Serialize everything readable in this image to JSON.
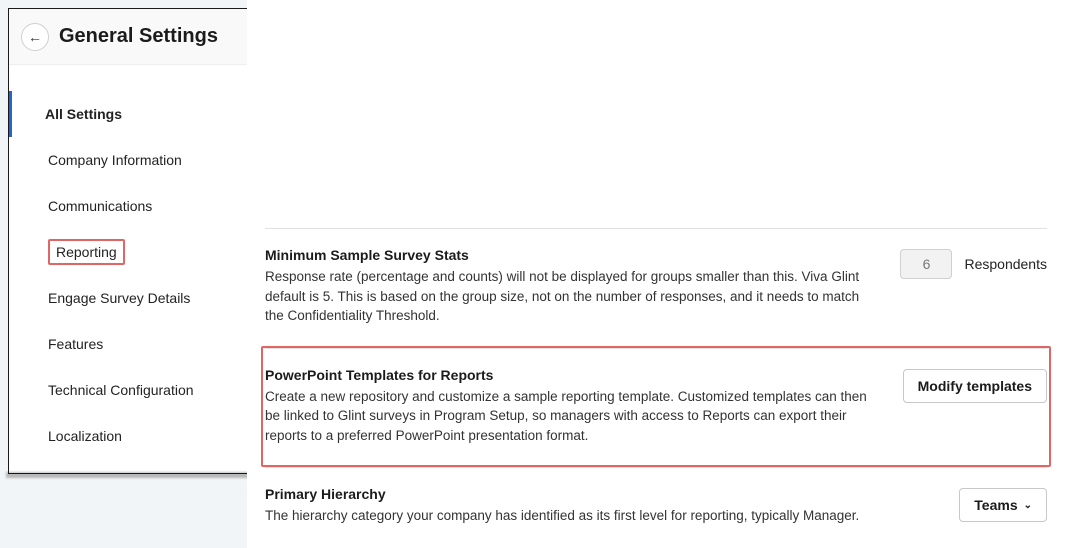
{
  "header": {
    "title": "General Settings",
    "back_icon": "←"
  },
  "sidebar": {
    "items": [
      {
        "label": "All Settings"
      },
      {
        "label": "Company Information"
      },
      {
        "label": "Communications"
      },
      {
        "label": "Reporting"
      },
      {
        "label": "Engage Survey Details"
      },
      {
        "label": "Features"
      },
      {
        "label": "Technical Configuration"
      },
      {
        "label": "Localization"
      }
    ]
  },
  "sections": {
    "min_sample": {
      "title": "Minimum Sample Survey Stats",
      "desc": "Response rate (percentage and counts) will not be displayed for groups smaller than this. Viva Glint default is 5. This is based on the group size, not on the number of responses, and it needs to match the Confidentiality Threshold.",
      "value": "6",
      "unit": "Respondents"
    },
    "ppt": {
      "title": "PowerPoint Templates for Reports",
      "desc": "Create a new repository and customize a sample reporting template. Customized templates can then be linked to Glint surveys in Program Setup, so managers with access to Reports can export their reports to a preferred PowerPoint presentation format.",
      "button": "Modify templates"
    },
    "hierarchy": {
      "title": "Primary Hierarchy",
      "desc": "The hierarchy category your company has identified as its first level for reporting, typically Manager.",
      "button": "Teams",
      "chevron": "⌄"
    }
  }
}
